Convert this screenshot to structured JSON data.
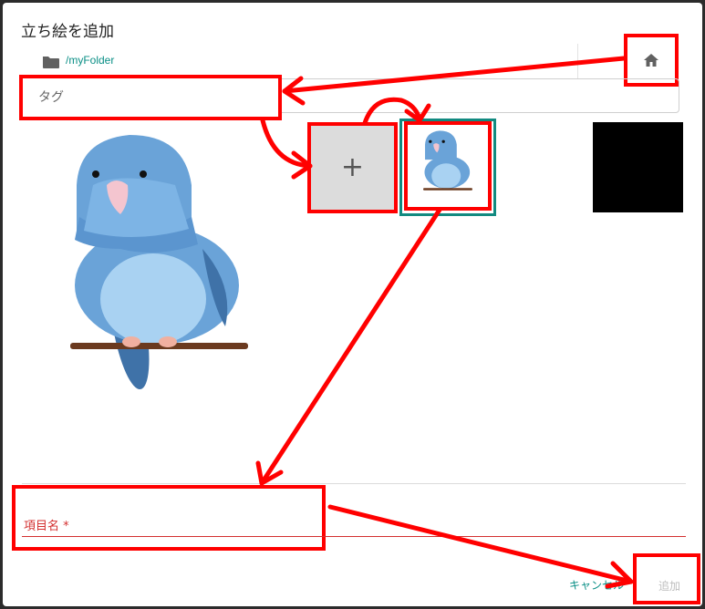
{
  "dialog": {
    "title": "立ち絵を追加",
    "folder_path": "/myFolder",
    "tag_placeholder": "タグ",
    "add_image_symbol": "+",
    "item_name_label": "項目名 *",
    "cancel_label": "キャンセル",
    "add_label": "追加"
  },
  "icons": {
    "folder": "folder-icon",
    "home": "home-icon",
    "plus": "plus-icon"
  },
  "colors": {
    "accent": "#0a8f86",
    "selection_border": "#128a80",
    "annotation": "#ff0000",
    "error": "#d32f2f"
  }
}
